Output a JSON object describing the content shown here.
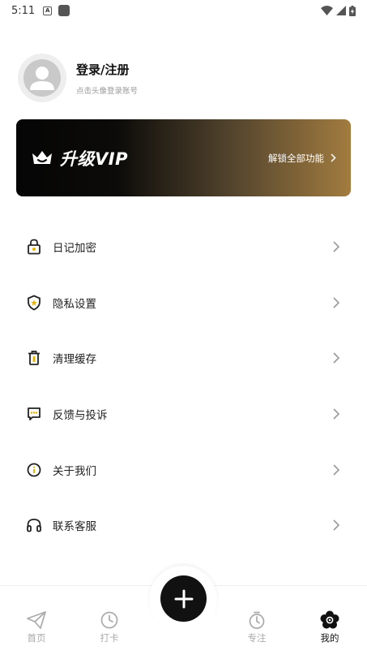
{
  "status_bar": {
    "time": "5:11",
    "a_badge": "A"
  },
  "profile": {
    "title": "登录/注册",
    "hint": "点击头像登录账号"
  },
  "vip": {
    "title": "升级VIP",
    "action": "解锁全部功能"
  },
  "menu": [
    {
      "label": "日记加密",
      "icon": "lock-icon"
    },
    {
      "label": "隐私设置",
      "icon": "shield-icon"
    },
    {
      "label": "清理缓存",
      "icon": "trash-icon"
    },
    {
      "label": "反馈与投诉",
      "icon": "feedback-icon"
    },
    {
      "label": "关于我们",
      "icon": "info-icon"
    },
    {
      "label": "联系客服",
      "icon": "headphones-icon"
    }
  ],
  "tabs": [
    {
      "label": "首页",
      "icon": "paper-plane-icon",
      "active": false
    },
    {
      "label": "打卡",
      "icon": "clock-icon",
      "active": false
    },
    {
      "label": "专注",
      "icon": "stopwatch-icon",
      "active": false
    },
    {
      "label": "我的",
      "icon": "flower-icon",
      "active": true
    }
  ],
  "colors": {
    "vip_gold": "#a27c3f",
    "active": "#111111",
    "inactive": "#aaaaaa"
  }
}
